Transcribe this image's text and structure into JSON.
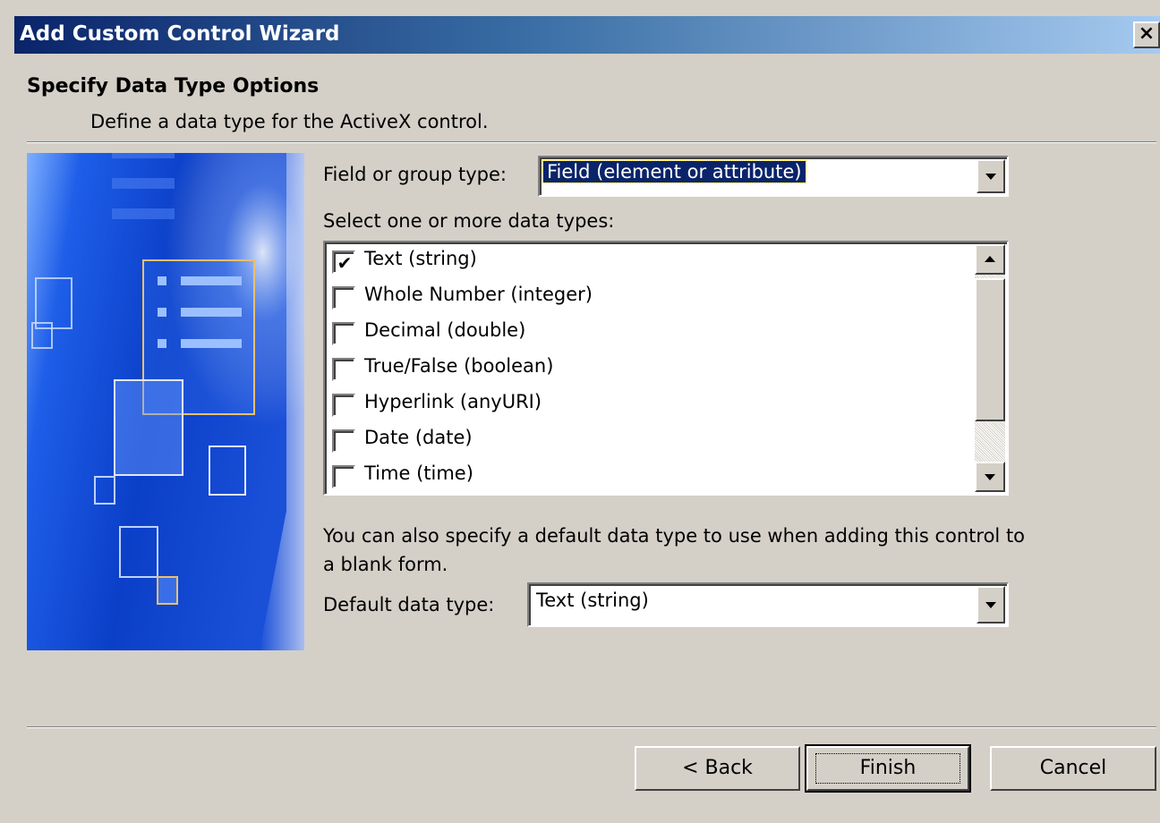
{
  "window": {
    "title": "Add Custom Control Wizard",
    "close_label": "×"
  },
  "header": {
    "title": "Specify Data Type Options",
    "subtitle": "Define a data type for the ActiveX control."
  },
  "field_type": {
    "label": "Field or group type:",
    "value": "Field (element or attribute)"
  },
  "data_types": {
    "label": "Select one or more data types:",
    "items": [
      {
        "label": "Text (string)",
        "checked": true
      },
      {
        "label": "Whole Number (integer)",
        "checked": false
      },
      {
        "label": "Decimal (double)",
        "checked": false
      },
      {
        "label": "True/False (boolean)",
        "checked": false
      },
      {
        "label": "Hyperlink (anyURI)",
        "checked": false
      },
      {
        "label": "Date (date)",
        "checked": false
      },
      {
        "label": "Time (time)",
        "checked": false
      }
    ]
  },
  "default_type": {
    "hint": "You can also specify a default data type to use when adding this control to a blank form.",
    "label": "Default data type:",
    "value": "Text (string)"
  },
  "buttons": {
    "back": "< Back",
    "finish": "Finish",
    "cancel": "Cancel"
  },
  "colors": {
    "dialog_bg": "#d4d0c8",
    "title_start": "#0a246a",
    "title_end": "#a6caf0",
    "selection": "#0a246a"
  }
}
